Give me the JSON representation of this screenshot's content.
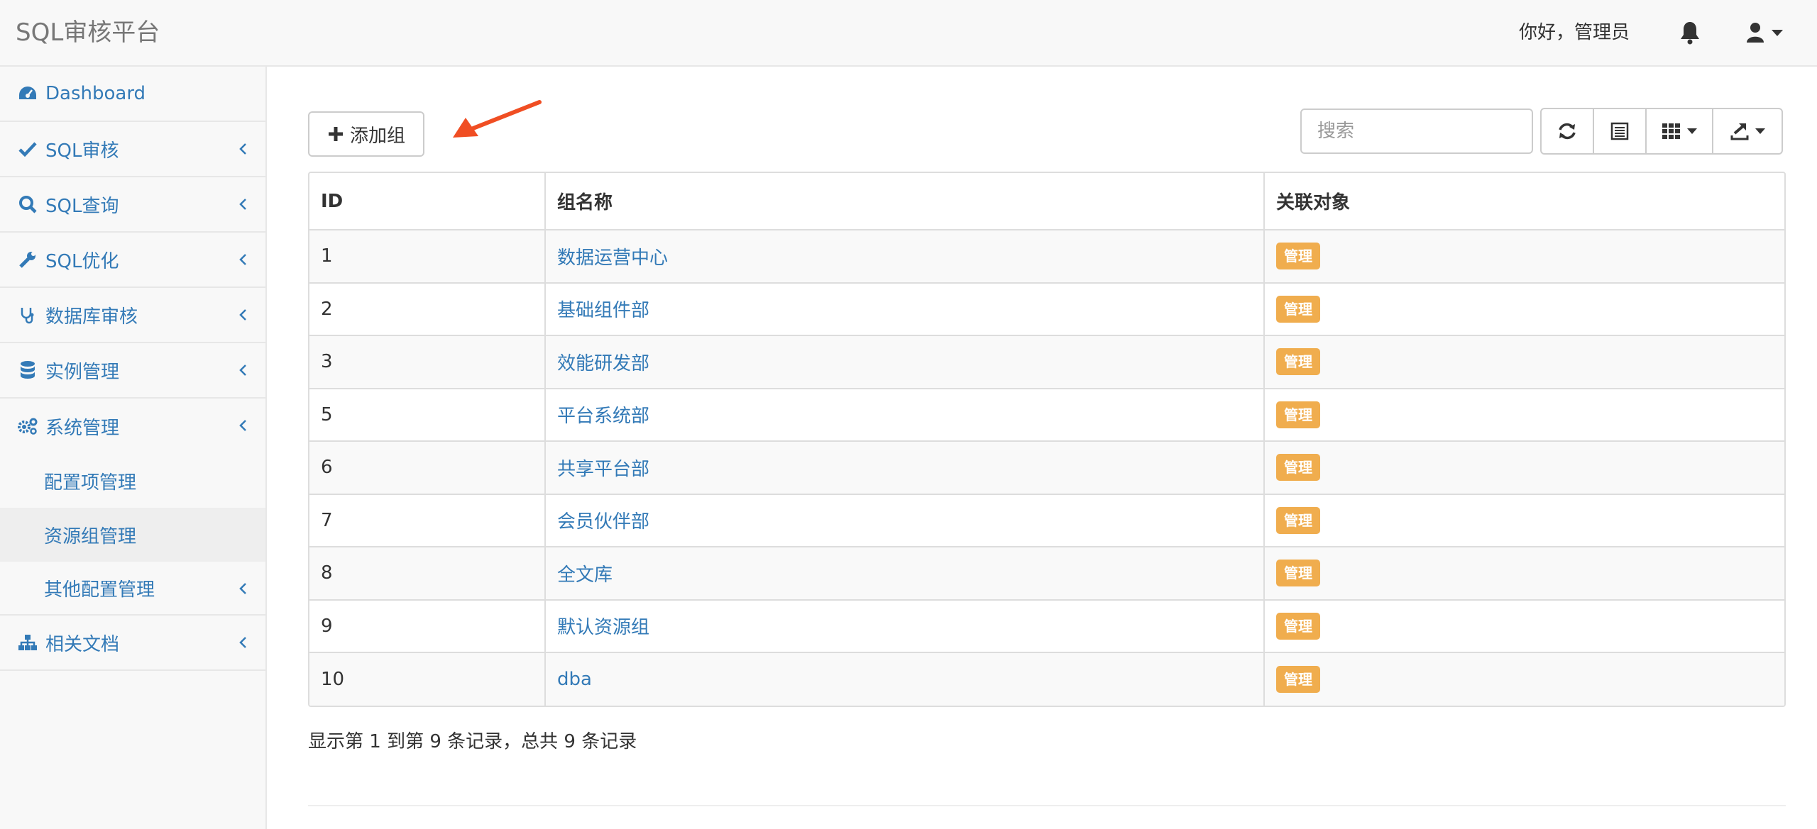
{
  "app": {
    "brand": "SQL审核平台",
    "greeting": "你好，管理员"
  },
  "icons": {
    "bell": "bell-icon",
    "user": "user-icon",
    "caret": "caret-down-icon",
    "refresh": "refresh-icon",
    "list": "list-icon",
    "columns": "columns-icon",
    "export": "export-icon",
    "plus": "plus-icon"
  },
  "sidebar": {
    "items": [
      {
        "label": "Dashboard",
        "icon": "dashboard-icon"
      },
      {
        "label": "SQL审核",
        "icon": "check-icon"
      },
      {
        "label": "SQL查询",
        "icon": "search-icon"
      },
      {
        "label": "SQL优化",
        "icon": "wrench-icon"
      },
      {
        "label": "数据库审核",
        "icon": "stethoscope-icon"
      },
      {
        "label": "实例管理",
        "icon": "database-icon"
      },
      {
        "label": "系统管理",
        "icon": "cogs-icon"
      }
    ],
    "sub": [
      {
        "label": "配置项管理"
      },
      {
        "label": "资源组管理"
      },
      {
        "label": "其他配置管理"
      }
    ],
    "docs": {
      "label": "相关文档",
      "icon": "sitemap-icon"
    }
  },
  "toolbar": {
    "add_label": "添加组",
    "search_placeholder": "搜索"
  },
  "table": {
    "headers": [
      "ID",
      "组名称",
      "关联对象"
    ],
    "rows": [
      {
        "id": "1",
        "name": "数据运营中心",
        "action": "管理"
      },
      {
        "id": "2",
        "name": "基础组件部",
        "action": "管理"
      },
      {
        "id": "3",
        "name": "效能研发部",
        "action": "管理"
      },
      {
        "id": "5",
        "name": "平台系统部",
        "action": "管理"
      },
      {
        "id": "6",
        "name": "共享平台部",
        "action": "管理"
      },
      {
        "id": "7",
        "name": "会员伙伴部",
        "action": "管理"
      },
      {
        "id": "8",
        "name": "全文库",
        "action": "管理"
      },
      {
        "id": "9",
        "name": "默认资源组",
        "action": "管理"
      },
      {
        "id": "10",
        "name": "dba",
        "action": "管理"
      }
    ]
  },
  "pagination": {
    "info": "显示第 1 到第 9 条记录，总共 9 条记录"
  },
  "colors": {
    "link": "#337ab7",
    "badge": "#f0ad4e",
    "arrow": "#f04e23"
  }
}
